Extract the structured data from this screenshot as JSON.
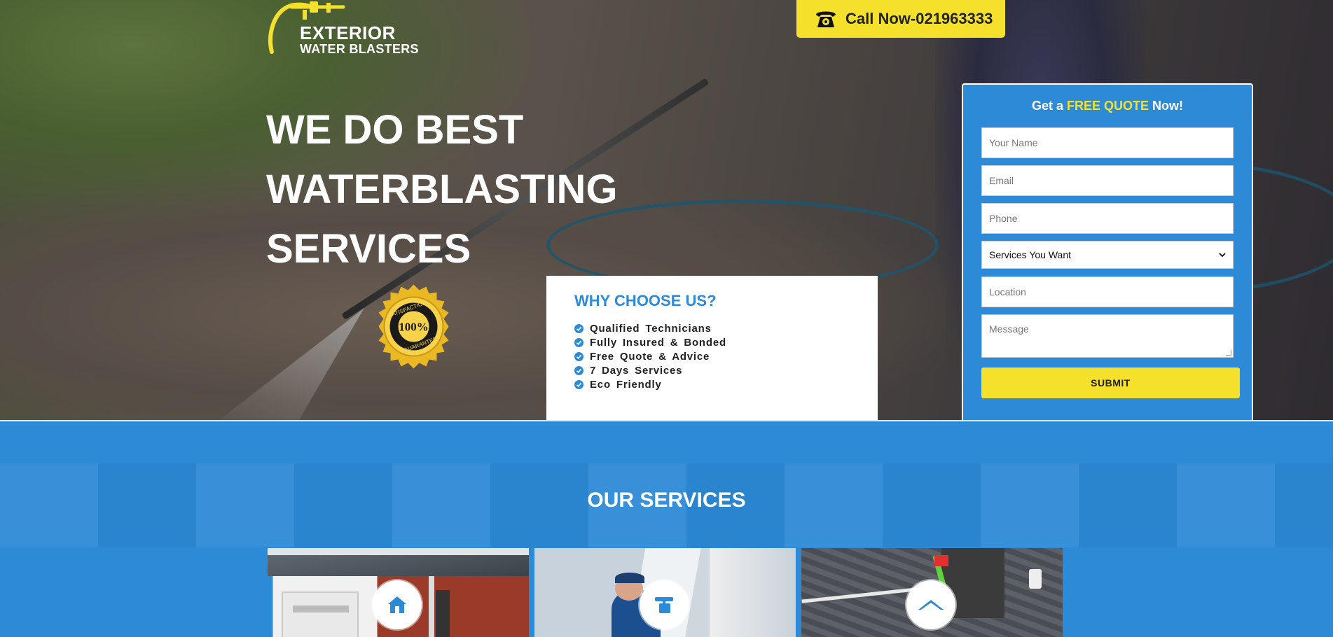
{
  "brand": {
    "line1": "EXTERIOR",
    "line2": "WATER BLASTERS"
  },
  "call": {
    "label": "Call Now-021963333",
    "icon": "telephone-icon"
  },
  "hero": {
    "headline_1": "WE DO BEST",
    "headline_2": "WATERBLASTING",
    "headline_3": "SERVICES",
    "seal_icon": "satisfaction-guarantee-seal"
  },
  "why": {
    "title": "WHY CHOOSE US?",
    "items": [
      "Qualified Technicians",
      "Fully Insured & Bonded",
      "Free Quote & Advice",
      "7 Days Services",
      "Eco Friendly"
    ]
  },
  "quote": {
    "title_pre": "Get a ",
    "title_highlight": "FREE QUOTE",
    "title_post": " Now!",
    "name_placeholder": "Your Name",
    "email_placeholder": "Email",
    "phone_placeholder": "Phone",
    "service_selected": "Services You Want",
    "location_placeholder": "Location",
    "message_placeholder": "Message",
    "submit_label": "SUBMIT"
  },
  "services": {
    "title": "OUR SERVICES",
    "cards": [
      {
        "icon": "house-icon"
      },
      {
        "icon": "window-cleaning-icon"
      },
      {
        "icon": "roof-icon"
      }
    ]
  },
  "colors": {
    "primary": "#2d8ad6",
    "accent": "#f5e12c",
    "white": "#ffffff"
  }
}
